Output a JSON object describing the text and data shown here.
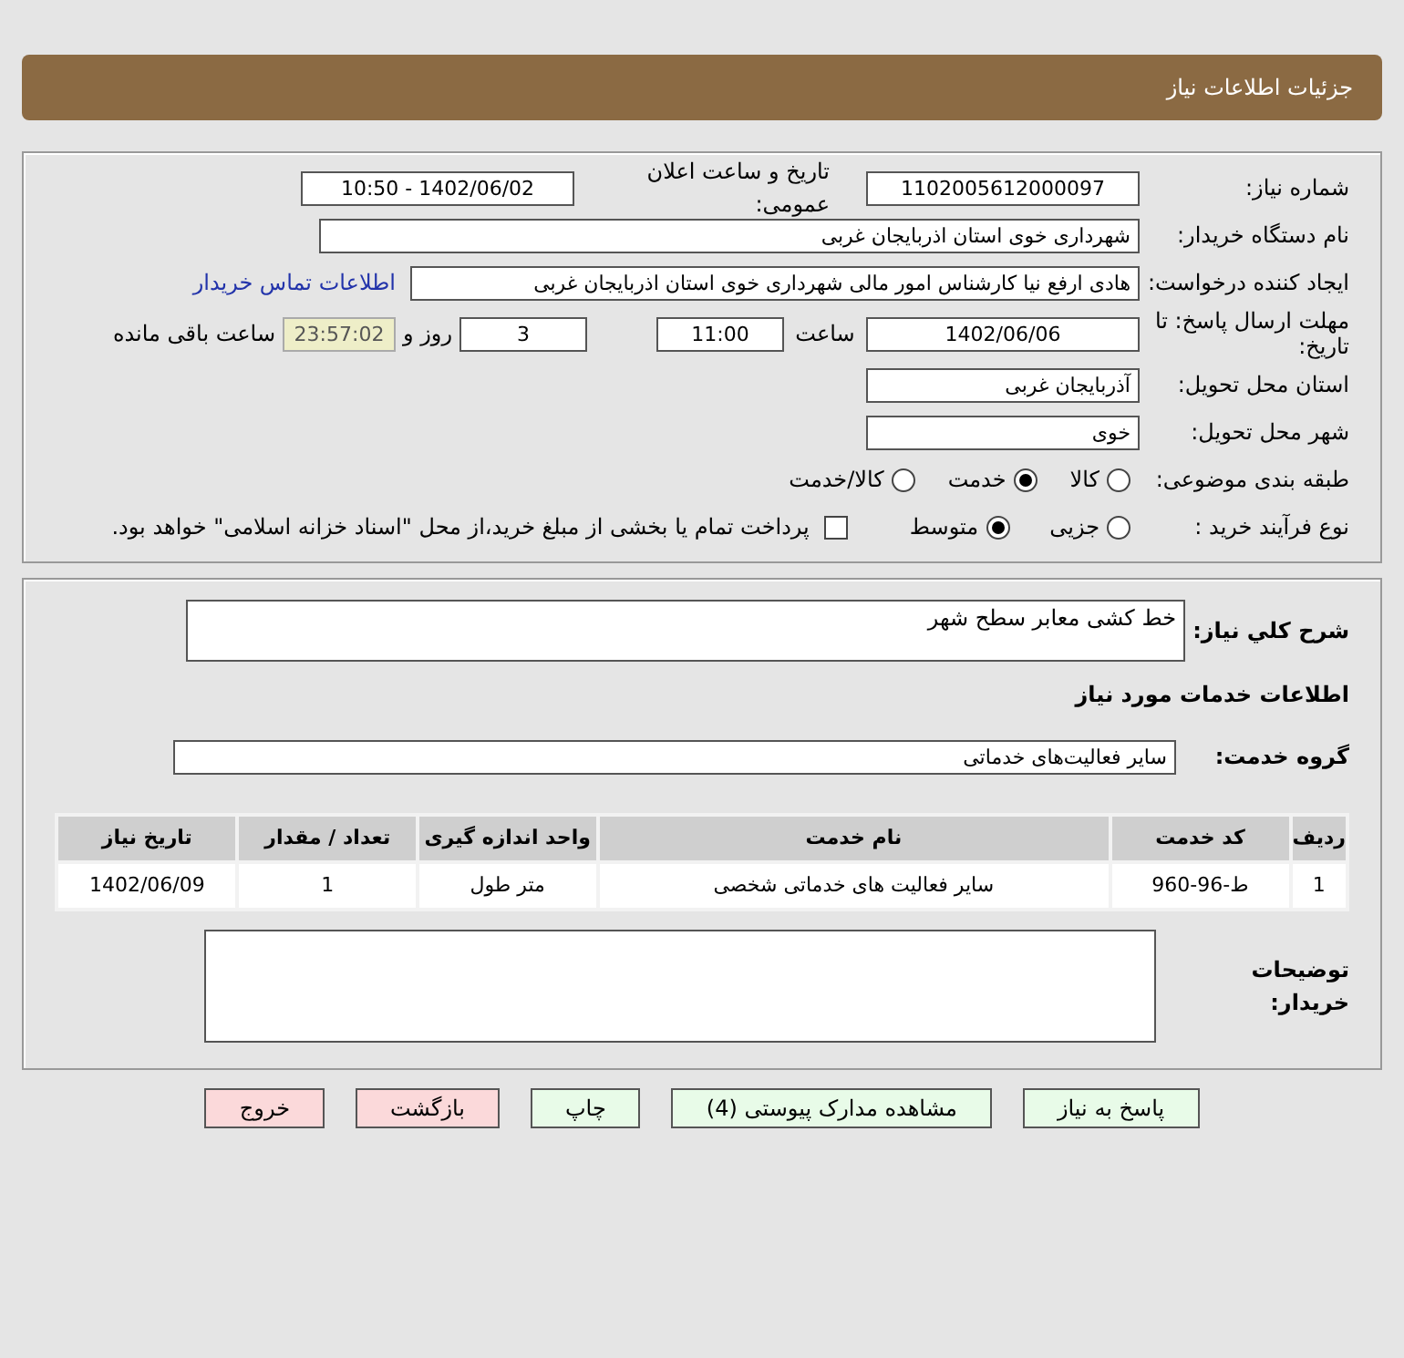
{
  "header": {
    "title": "جزئیات اطلاعات نیاز"
  },
  "need_number": {
    "label": "شماره نیاز:",
    "value": "1102005612000097"
  },
  "announce": {
    "label": "تاریخ و ساعت اعلان عمومی:",
    "value": "1402/06/02 - 10:50"
  },
  "buyer_org": {
    "label": "نام دستگاه خریدار:",
    "value": "شهرداری خوی استان اذربایجان غربی"
  },
  "requester": {
    "label": "ایجاد کننده درخواست:",
    "value": "هادی ارفع نیا کارشناس امور مالی شهرداری خوی استان اذربایجان غربی",
    "contact_link": "اطلاعات تماس خریدار"
  },
  "deadline": {
    "label": "مهلت ارسال پاسخ: تا تاریخ:",
    "date": "1402/06/06",
    "time_label": "ساعت",
    "time": "11:00",
    "days": "3",
    "days_label": "روز و",
    "remaining": "23:57:02",
    "remaining_label": "ساعت باقی مانده"
  },
  "province": {
    "label": "استان محل تحویل:",
    "value": "آذربایجان غربی"
  },
  "city": {
    "label": "شهر محل تحویل:",
    "value": "خوی"
  },
  "category": {
    "label": "طبقه بندی موضوعی:",
    "options": [
      {
        "label": "کالا",
        "selected": false
      },
      {
        "label": "خدمت",
        "selected": true
      },
      {
        "label": "کالا/خدمت",
        "selected": false
      }
    ]
  },
  "process": {
    "label": "نوع فرآیند خرید :",
    "options": [
      {
        "label": "جزیی",
        "selected": false
      },
      {
        "label": "متوسط",
        "selected": true
      }
    ],
    "payment": {
      "checked": false,
      "label": "پرداخت تمام یا بخشی از مبلغ خرید،از محل \"اسناد خزانه اسلامی\" خواهد بود."
    }
  },
  "description": {
    "label": "شرح کلي نياز:",
    "value": "خط کشی معابر سطح شهر"
  },
  "services_heading": "اطلاعات خدمات مورد نیاز",
  "service_group": {
    "label": "گروه خدمت:",
    "value": "سایر فعالیت‌های خدماتی"
  },
  "table": {
    "columns": [
      "ردیف",
      "کد خدمت",
      "نام خدمت",
      "واحد اندازه گیری",
      "تعداد / مقدار",
      "تاریخ نیاز"
    ],
    "rows": [
      [
        "1",
        "ط-96-960",
        "سایر فعالیت های خدماتی شخصی",
        "متر طول",
        "1",
        "1402/06/09"
      ]
    ]
  },
  "buyer_notes": {
    "label": "توضیحات خریدار:"
  },
  "buttons": [
    {
      "label": "پاسخ به نیاز",
      "kind": "primary"
    },
    {
      "label": "مشاهده مدارک پیوستی (4)",
      "kind": "primary"
    },
    {
      "label": "چاپ",
      "kind": "primary"
    },
    {
      "label": "بازگشت",
      "kind": "danger"
    },
    {
      "label": "خروج",
      "kind": "danger"
    }
  ]
}
